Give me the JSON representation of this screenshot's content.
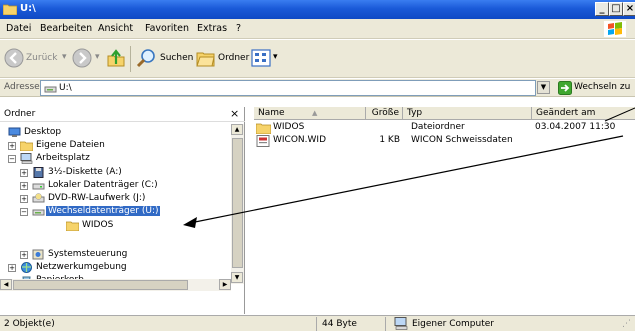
{
  "window": {
    "title": "U:\\"
  },
  "window_buttons": {
    "minimize": "_",
    "maximize": "□",
    "close": "×"
  },
  "menu": [
    "Datei",
    "Bearbeiten",
    "Ansicht",
    "Favoriten",
    "Extras",
    "?"
  ],
  "toolbar": {
    "back": "Zurück",
    "search": "Suchen",
    "folders": "Ordner"
  },
  "address": {
    "label": "Adresse",
    "value": "U:\\",
    "go": "Wechseln zu"
  },
  "folder_pane": {
    "title": "Ordner",
    "close": "×",
    "tree": [
      {
        "label": "Desktop",
        "icon": "desktop-icon"
      },
      {
        "label": "Eigene Dateien",
        "icon": "folder-icon"
      },
      {
        "label": "Arbeitsplatz",
        "icon": "computer-icon"
      },
      {
        "label": "3½-Diskette (A:)",
        "icon": "floppy-icon"
      },
      {
        "label": "Lokaler Datenträger (C:)",
        "icon": "drive-icon"
      },
      {
        "label": "DVD-RW-Laufwerk (J:)",
        "icon": "dvd-icon"
      },
      {
        "label": "Wechseldatenträger (U:)",
        "icon": "removable-drive-icon"
      },
      {
        "label": "WIDOS",
        "icon": "folder-icon"
      },
      {
        "label": "Systemsteuerung",
        "icon": "control-panel-icon"
      },
      {
        "label": "Netzwerkumgebung",
        "icon": "network-icon"
      },
      {
        "label": "Papierkorb",
        "icon": "recycle-bin-icon"
      }
    ]
  },
  "list": {
    "columns": [
      "Name",
      "Größe",
      "Typ",
      "Geändert am"
    ],
    "rows": [
      {
        "name": "WIDOS",
        "size": "",
        "type": "Dateiordner",
        "modified": "03.04.2007 11:30",
        "icon": "folder-icon"
      },
      {
        "name": "WICON.WID",
        "size": "1 KB",
        "type": "WICON Schweissdaten",
        "modified": "",
        "icon": "wid-file-icon"
      }
    ]
  },
  "status": {
    "objects": "2 Objekt(e)",
    "size": "44 Byte",
    "location": "Eigener Computer"
  },
  "colors": {
    "title_bar": "#1a5ad8",
    "selection": "#316ac5",
    "chrome": "#ece9d8"
  }
}
